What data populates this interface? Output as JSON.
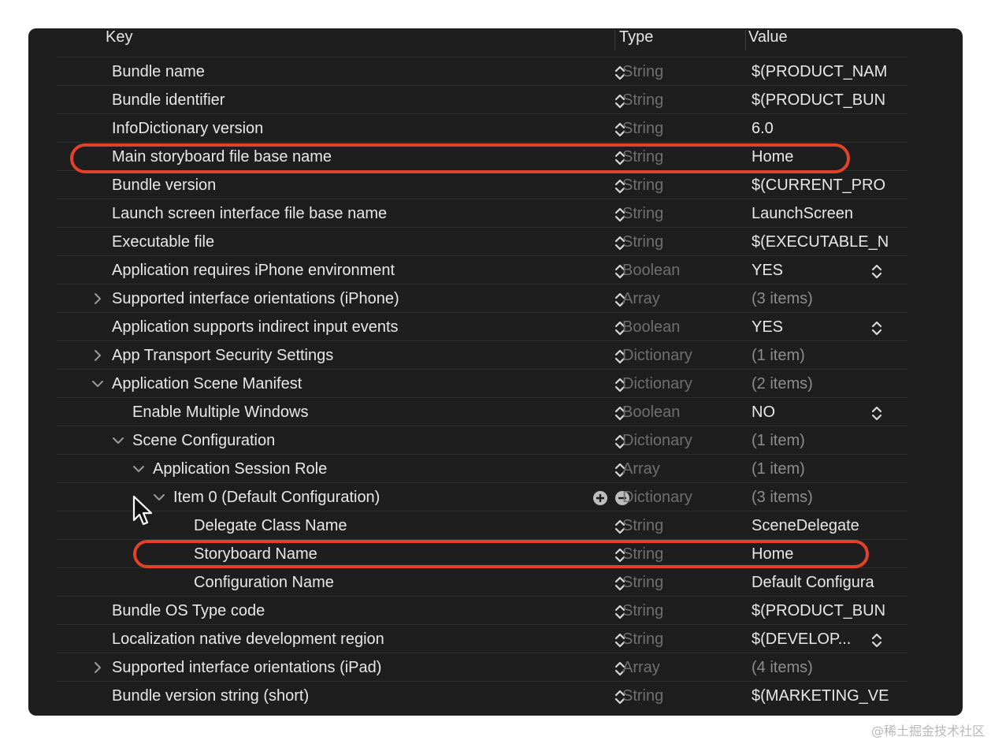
{
  "columns": {
    "key": "Key",
    "type": "Type",
    "value": "Value"
  },
  "rows": [
    {
      "key": "Bundle name",
      "type": "String",
      "value": "$(PRODUCT_NAM"
    },
    {
      "key": "Bundle identifier",
      "type": "String",
      "value": "$(PRODUCT_BUN"
    },
    {
      "key": "InfoDictionary version",
      "type": "String",
      "value": "6.0"
    },
    {
      "key": "Main storyboard file base name",
      "type": "String",
      "value": "Home"
    },
    {
      "key": "Bundle version",
      "type": "String",
      "value": "$(CURRENT_PRO"
    },
    {
      "key": "Launch screen interface file base name",
      "type": "String",
      "value": "LaunchScreen"
    },
    {
      "key": "Executable file",
      "type": "String",
      "value": "$(EXECUTABLE_N"
    },
    {
      "key": "Application requires iPhone environment",
      "type": "Boolean",
      "value": "YES"
    },
    {
      "key": "Supported interface orientations (iPhone)",
      "type": "Array",
      "value": "(3 items)"
    },
    {
      "key": "Application supports indirect input events",
      "type": "Boolean",
      "value": "YES"
    },
    {
      "key": "App Transport Security Settings",
      "type": "Dictionary",
      "value": "(1 item)"
    },
    {
      "key": "Application Scene Manifest",
      "type": "Dictionary",
      "value": "(2 items)"
    },
    {
      "key": "Enable Multiple Windows",
      "type": "Boolean",
      "value": "NO"
    },
    {
      "key": "Scene Configuration",
      "type": "Dictionary",
      "value": "(1 item)"
    },
    {
      "key": "Application Session Role",
      "type": "Array",
      "value": "(1 item)"
    },
    {
      "key": "Item 0 (Default Configuration)",
      "type": "Dictionary",
      "value": "(3 items)"
    },
    {
      "key": "Delegate Class Name",
      "type": "String",
      "value": "SceneDelegate"
    },
    {
      "key": "Storyboard Name",
      "type": "String",
      "value": "Home"
    },
    {
      "key": "Configuration Name",
      "type": "String",
      "value": "Default Configura"
    },
    {
      "key": "Bundle OS Type code",
      "type": "String",
      "value": "$(PRODUCT_BUN"
    },
    {
      "key": "Localization native development region",
      "type": "String",
      "value": "$(DEVELOP..."
    },
    {
      "key": "Supported interface orientations (iPad)",
      "type": "Array",
      "value": "(4 items)"
    },
    {
      "key": "Bundle version string (short)",
      "type": "String",
      "value": "$(MARKETING_VE"
    }
  ],
  "watermark": "@稀土掘金技术社区",
  "colors": {
    "highlight": "#e2422a",
    "background": "#1e1e1e"
  }
}
